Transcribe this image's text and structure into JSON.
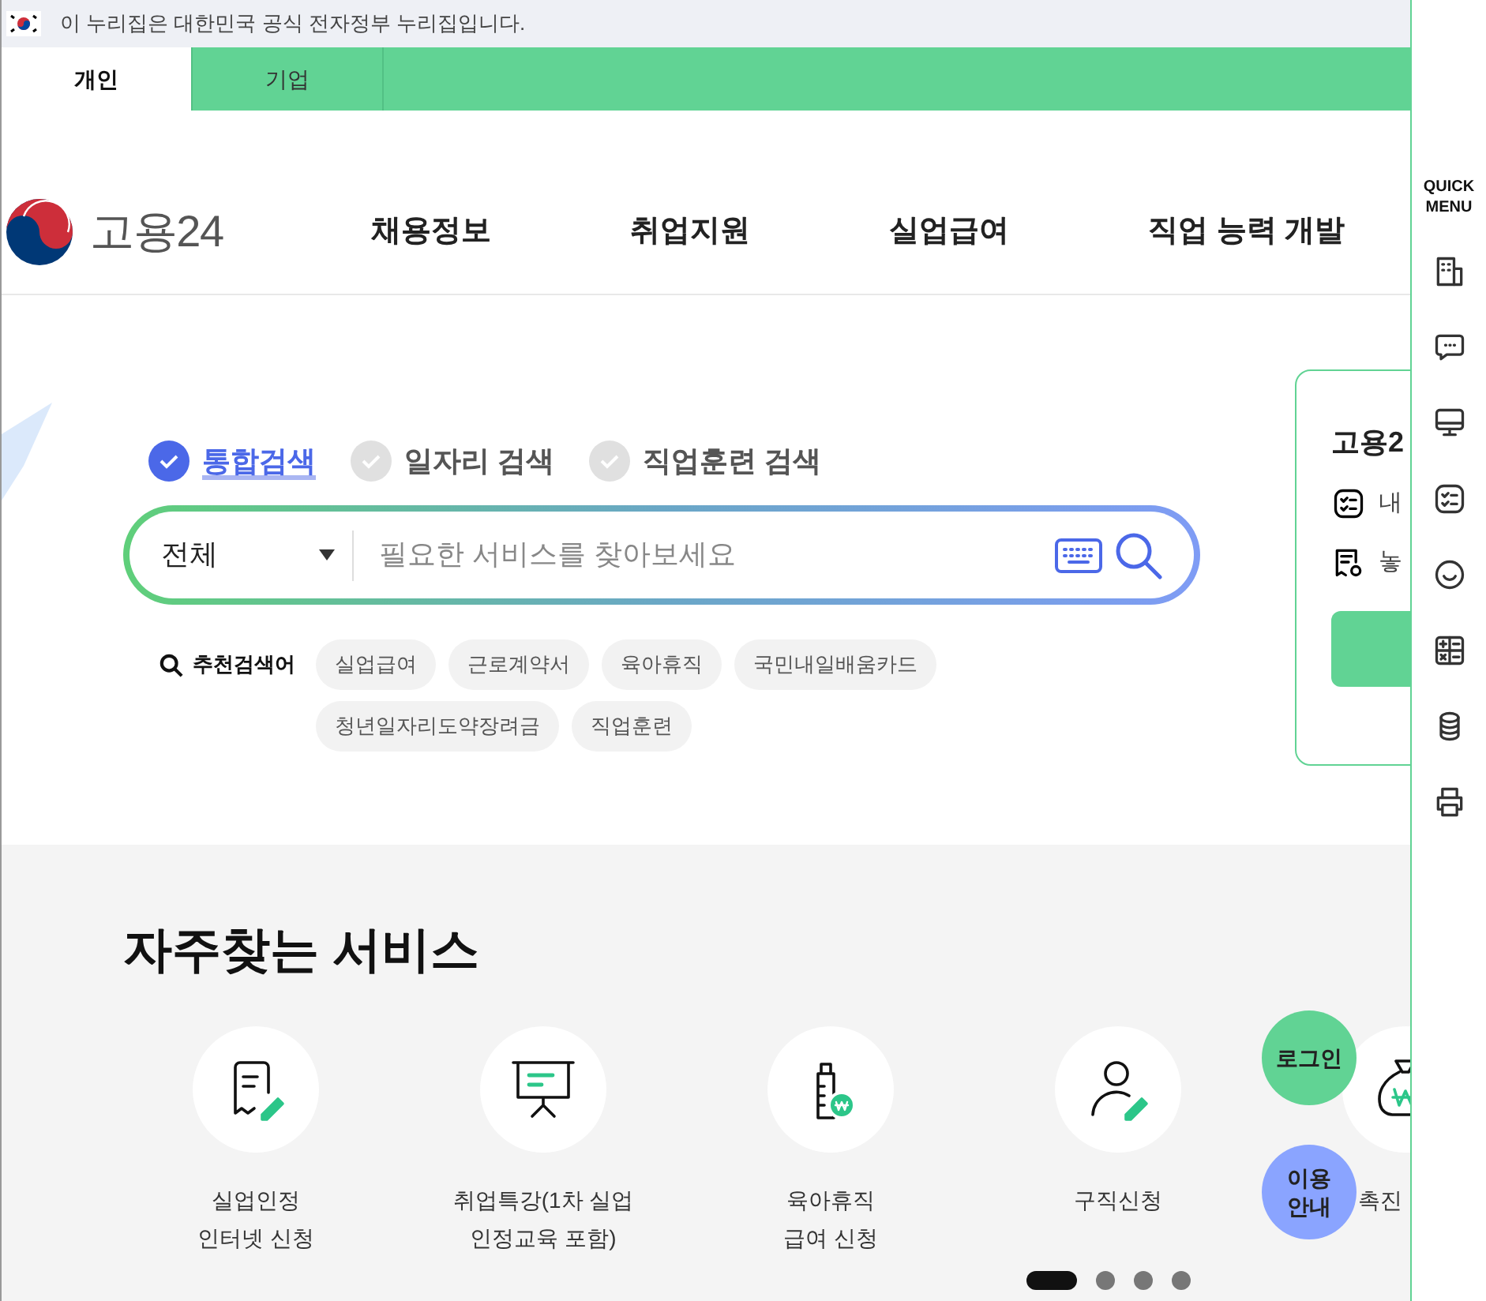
{
  "gov_banner": {
    "text": "이 누리집은 대한민국 공식 전자정부 누리집입니다."
  },
  "audience_tabs": [
    {
      "label": "개인",
      "selected": true
    },
    {
      "label": "기업",
      "selected": false
    }
  ],
  "header": {
    "logo_text": "고용24",
    "nav": [
      "채용정보",
      "취업지원",
      "실업급여",
      "직업 능력 개발"
    ]
  },
  "search": {
    "types": [
      {
        "label": "통합검색",
        "selected": true
      },
      {
        "label": "일자리 검색",
        "selected": false
      },
      {
        "label": "직업훈련 검색",
        "selected": false
      }
    ],
    "category": "전체",
    "placeholder": "필요한 서비스를 찾아보세요",
    "recommended_label": "추천검색어",
    "keywords": [
      "실업급여",
      "근로계약서",
      "육아휴직",
      "국민내일배움카드",
      "청년일자리도약장려금",
      "직업훈련"
    ]
  },
  "side_card": {
    "title": "고용2",
    "items": [
      {
        "kind": "checklist",
        "label": "내"
      },
      {
        "kind": "receipt",
        "label": "놓"
      }
    ]
  },
  "frequent_services": {
    "title": "자주찾는 서비스",
    "items": [
      {
        "kind": "receipt",
        "lines": [
          "실업인정",
          "인터넷 신청"
        ]
      },
      {
        "kind": "board",
        "lines": [
          "취업특강(1차 실업",
          "인정교육 포함)"
        ]
      },
      {
        "kind": "bottle",
        "lines": [
          "육아휴직",
          "급여 신청"
        ]
      },
      {
        "kind": "person",
        "lines": [
          "구직신청"
        ]
      },
      {
        "kind": "moneybag",
        "lines": [
          "촉진"
        ]
      }
    ],
    "pages": [
      {
        "selected": true
      },
      {
        "selected": false
      },
      {
        "selected": false
      },
      {
        "selected": false
      }
    ]
  },
  "floating": {
    "login": "로그인",
    "guide": [
      "이용",
      "안내"
    ]
  },
  "quick_menu": {
    "title": [
      "QUICK",
      "MENU"
    ]
  }
}
